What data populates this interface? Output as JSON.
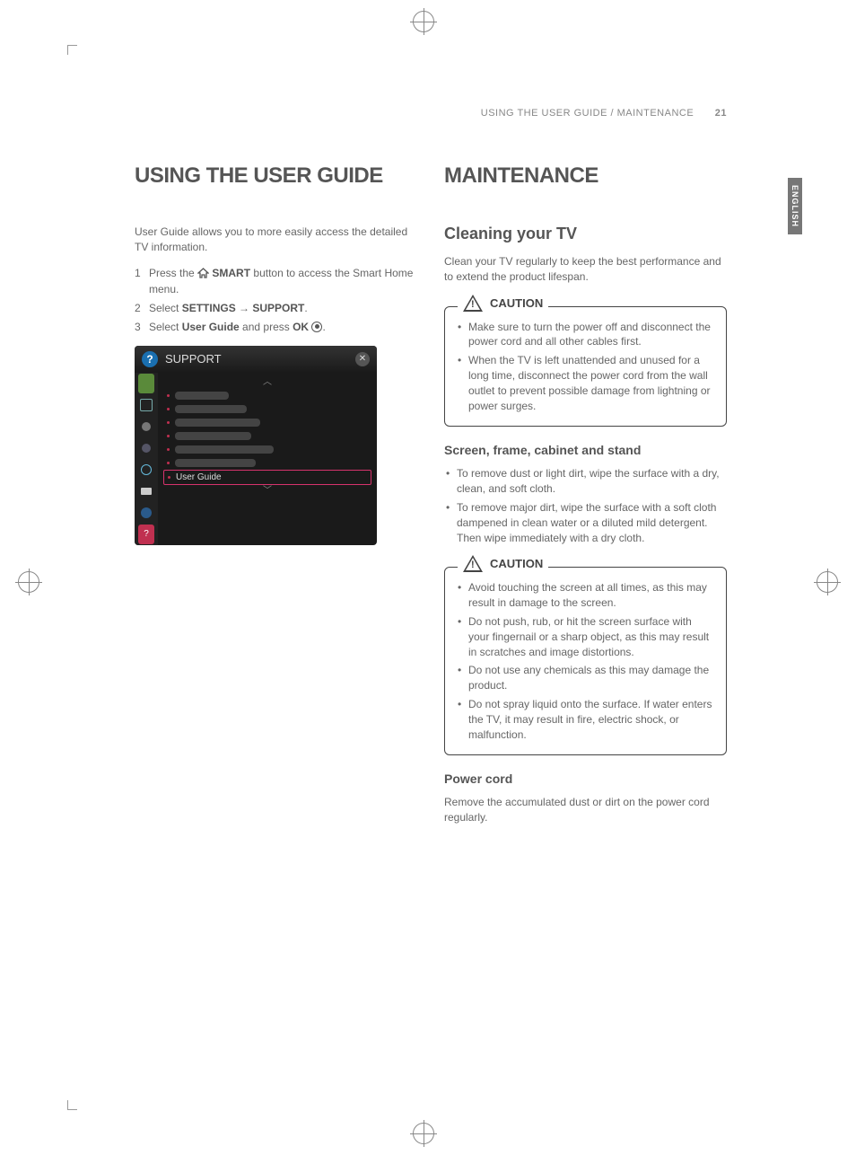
{
  "runningHead": {
    "title": "USING THE USER GUIDE / MAINTENANCE",
    "page": "21"
  },
  "langTab": "ENGLISH",
  "left": {
    "h1": "USING THE USER GUIDE",
    "intro": "User Guide allows you to more easily access the detailed TV information.",
    "steps": {
      "s1a": "Press the ",
      "s1b": "SMART",
      "s1c": " button to access the Smart Home menu.",
      "s2a": "Select ",
      "s2b": "SETTINGS",
      "s2arrow": " → ",
      "s2c": "SUPPORT",
      "s2d": ".",
      "s3a": "Select ",
      "s3b": "User Guide",
      "s3c": " and press ",
      "s3d": "OK",
      "s3e": "."
    },
    "tv": {
      "title": "SUPPORT",
      "selected": "User Guide"
    }
  },
  "right": {
    "h1": "MAINTENANCE",
    "h2a": "Cleaning your TV",
    "p1": "Clean your TV regularly to keep the best performance and to extend the product lifespan.",
    "caution1Label": "CAUTION",
    "caution1": {
      "b1": "Make sure to turn the power off and disconnect the power cord and all other cables first.",
      "b2": "When the TV is left unattended and unused for a long time, disconnect the power cord from the wall outlet to prevent possible damage from lightning or power surges."
    },
    "h3a": "Screen, frame, cabinet and stand",
    "list1": {
      "b1": "To remove dust or light dirt, wipe the surface with a dry, clean, and soft cloth.",
      "b2": "To remove major dirt, wipe the surface with a soft cloth dampened in clean water or a diluted mild detergent. Then wipe immediately with a dry cloth."
    },
    "caution2Label": "CAUTION",
    "caution2": {
      "b1": "Avoid touching the screen at all times, as this may result in damage to the screen.",
      "b2": "Do not push, rub, or hit the screen surface with your fingernail or a sharp object, as this may result in scratches and image distortions.",
      "b3": "Do not use any chemicals as this may damage the product.",
      "b4": "Do not spray liquid onto the surface. If water enters the TV, it may result in fire, electric shock, or malfunction."
    },
    "h3b": "Power cord",
    "p2": "Remove the accumulated dust or dirt on the power cord regularly."
  }
}
